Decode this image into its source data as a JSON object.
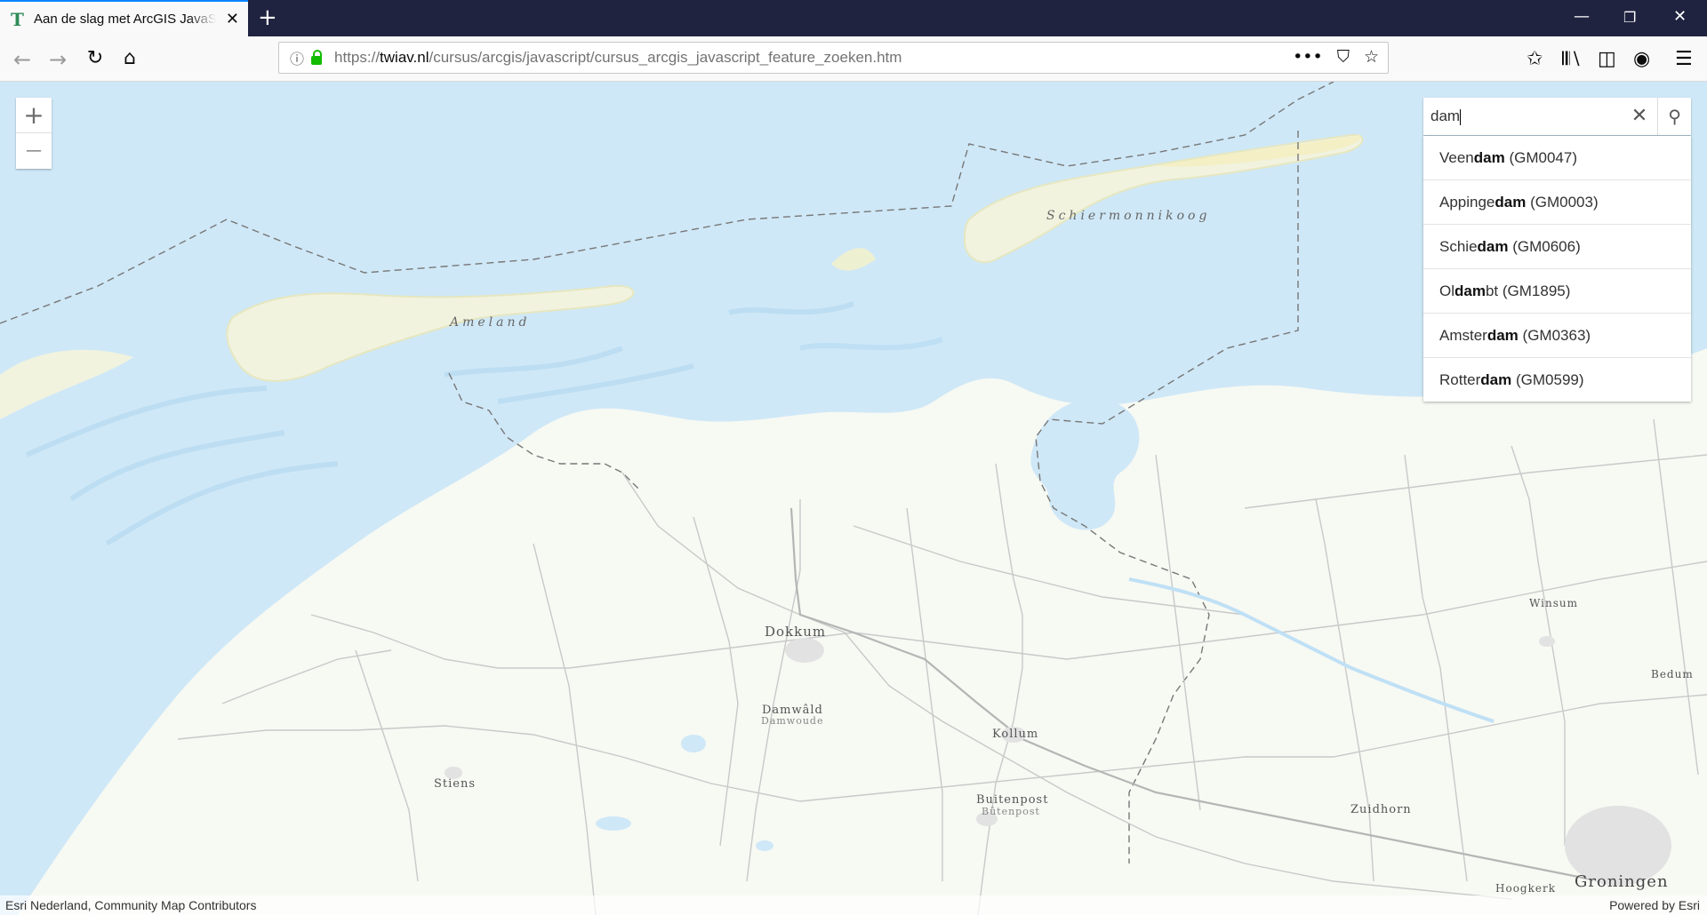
{
  "browser": {
    "tab_title": "Aan de slag met ArcGIS JavaScript",
    "tab_favicon": "T",
    "url_prefix": "https://",
    "url_host": "twiav.nl",
    "url_path": "/cursus/arcgis/javascript/cursus_arcgis_javascript_feature_zoeken.htm",
    "icons": [
      "back-icon",
      "forward-icon",
      "reload-icon",
      "home-icon",
      "info-icon",
      "lock-icon",
      "more-icon",
      "pocket-icon",
      "bookmark-star-icon",
      "library-icon",
      "sidebar-icon",
      "account-icon",
      "menu-icon"
    ]
  },
  "map": {
    "zoom_in": "+",
    "zoom_out": "—",
    "search": {
      "value": "dam",
      "suggestions": [
        {
          "pre": "Veen",
          "match": "dam",
          "post": " (GM0047)"
        },
        {
          "pre": "Appinge",
          "match": "dam",
          "post": " (GM0003)"
        },
        {
          "pre": "Schie",
          "match": "dam",
          "post": " (GM0606)"
        },
        {
          "pre": "Ol",
          "match": "dam",
          "post": "bt (GM1895)"
        },
        {
          "pre": "Amster",
          "match": "dam",
          "post": " (GM0363)"
        },
        {
          "pre": "Rotter",
          "match": "dam",
          "post": " (GM0599)"
        }
      ]
    },
    "labels": {
      "schiermonnikoog": "Schiermonnikoog",
      "ameland": "Ameland",
      "dokkum": "Dokkum",
      "damwald": "Damwâld",
      "damwoude": "Damwoude",
      "kollum": "Kollum",
      "stiens": "Stiens",
      "buitenpost": "Buitenpost",
      "butenpost": "Bûtenpost",
      "zuidhorn": "Zuidhorn",
      "winsum": "Winsum",
      "bedum": "Bedum",
      "groningen": "Groningen",
      "hoogkerk": "Hoogkerk"
    },
    "attribution_left": "Esri Nederland, Community Map Contributors",
    "attribution_right": "Powered by Esri",
    "colors": {
      "water": "#cfe8f7",
      "land": "#f7f9f3",
      "sand": "#f3f1d6"
    }
  }
}
